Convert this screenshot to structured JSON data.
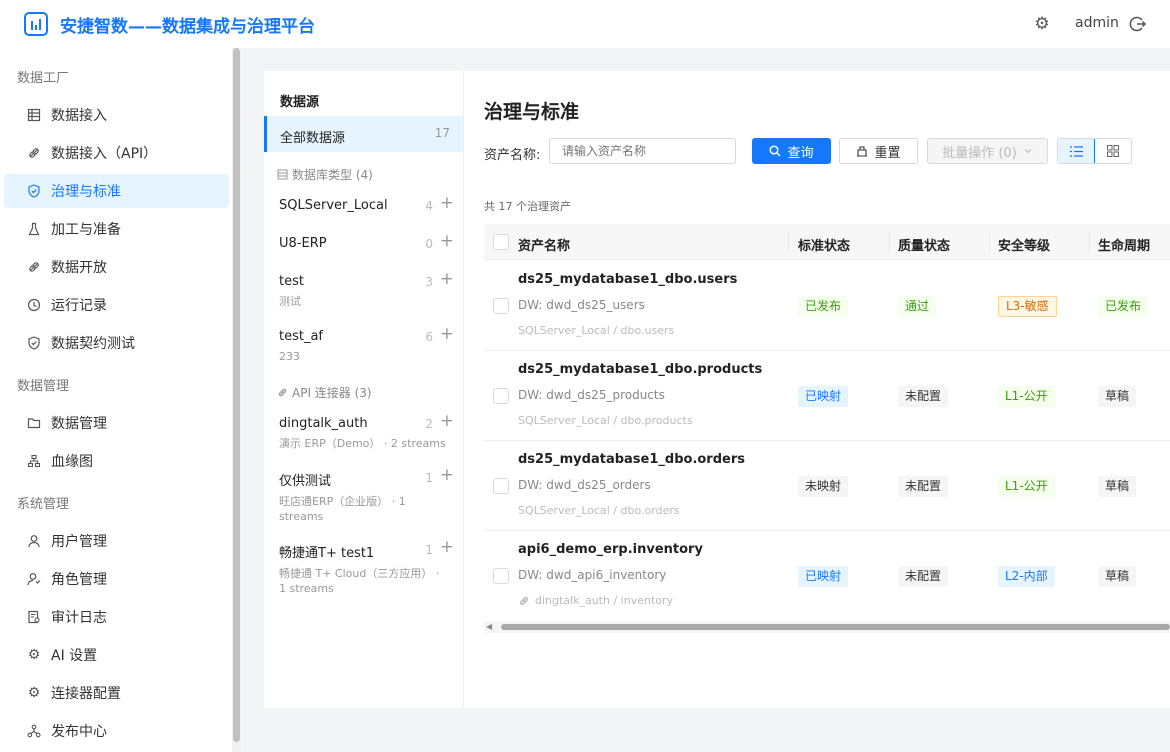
{
  "header": {
    "title": "安捷智数——数据集成与治理平台",
    "user": "admin"
  },
  "sidebar": {
    "groups": [
      {
        "label": "数据工厂",
        "items": [
          {
            "label": "数据接入",
            "icon": "table-icon"
          },
          {
            "label": "数据接入（API）",
            "icon": "plug-icon"
          },
          {
            "label": "治理与标准",
            "icon": "shield-icon",
            "active": true
          },
          {
            "label": "加工与准备",
            "icon": "flask-icon"
          },
          {
            "label": "数据开放",
            "icon": "plug-icon"
          },
          {
            "label": "运行记录",
            "icon": "clock-icon"
          },
          {
            "label": "数据契约测试",
            "icon": "shield-icon"
          }
        ]
      },
      {
        "label": "数据管理",
        "items": [
          {
            "label": "数据管理",
            "icon": "folder-icon"
          },
          {
            "label": "血缘图",
            "icon": "sitemap-icon"
          }
        ]
      },
      {
        "label": "系统管理",
        "items": [
          {
            "label": "用户管理",
            "icon": "user-icon"
          },
          {
            "label": "角色管理",
            "icon": "role-icon"
          },
          {
            "label": "审计日志",
            "icon": "audit-icon"
          },
          {
            "label": "AI 设置",
            "icon": "gear-icon"
          },
          {
            "label": "连接器配置",
            "icon": "gear-icon"
          },
          {
            "label": "发布中心",
            "icon": "publish-icon"
          }
        ]
      }
    ]
  },
  "datasource": {
    "title": "数据源",
    "all": {
      "label": "全部数据源",
      "count": "17"
    },
    "db_section": "数据库类型 (4)",
    "db_items": [
      {
        "name": "SQLServer_Local",
        "count": "4",
        "sub": ""
      },
      {
        "name": "U8-ERP",
        "count": "0",
        "sub": ""
      },
      {
        "name": "test",
        "count": "3",
        "sub": "测试"
      },
      {
        "name": "test_af",
        "count": "6",
        "sub": "233"
      }
    ],
    "api_section": "API 连接器 (3)",
    "api_items": [
      {
        "name": "dingtalk_auth",
        "count": "2",
        "sub": "演示 ERP（Demo） · 2 streams"
      },
      {
        "name": "仅供测试",
        "count": "1",
        "sub": "旺店通ERP（企业版） · 1 streams"
      },
      {
        "name": "畅捷通T+ test1",
        "count": "1",
        "sub": "畅捷通 T+ Cloud（三方应用） · 1 streams"
      }
    ]
  },
  "main": {
    "title": "治理与标准",
    "filter_label": "资产名称:",
    "filter_placeholder": "请输入资产名称",
    "search_btn": "查询",
    "reset_btn": "重置",
    "batch_btn": "批量操作 (0)",
    "total": "共 17 个治理资产",
    "columns": [
      "资产名称",
      "标准状态",
      "质量状态",
      "安全等级",
      "生命周期"
    ],
    "rows": [
      {
        "name": "ds25_mydatabase1_dbo.users",
        "dw": "DW: dwd_ds25_users",
        "src": "SQLServer_Local / dbo.users",
        "std": "已发布",
        "quality": "通过",
        "security": "L3-敏感",
        "lifecycle": "已发布"
      },
      {
        "name": "ds25_mydatabase1_dbo.products",
        "dw": "DW: dwd_ds25_products",
        "src": "SQLServer_Local / dbo.products",
        "std": "已映射",
        "quality": "未配置",
        "security": "L1-公开",
        "lifecycle": "草稿"
      },
      {
        "name": "ds25_mydatabase1_dbo.orders",
        "dw": "DW: dwd_ds25_orders",
        "src": "SQLServer_Local / dbo.orders",
        "std": "未映射",
        "quality": "未配置",
        "security": "L1-公开",
        "lifecycle": "草稿"
      },
      {
        "name": "api6_demo_erp.inventory",
        "dw": "DW: dwd_api6_inventory",
        "src": "dingtalk_auth / inventory",
        "std": "已映射",
        "quality": "未配置",
        "security": "L2-内部",
        "lifecycle": "草稿"
      }
    ]
  },
  "colors": {
    "primary": "#1677ff"
  }
}
